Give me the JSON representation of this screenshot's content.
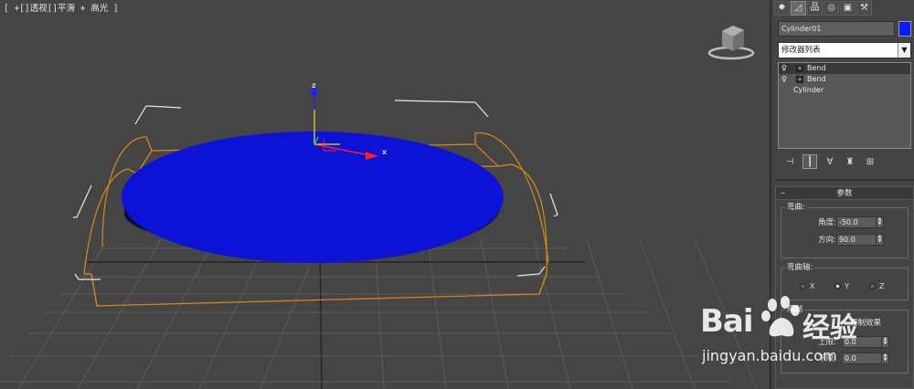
{
  "viewport": {
    "label": "[ +[]透视[]平滑 + 高光 ]",
    "axis_labels": {
      "x": "x",
      "z": "z"
    },
    "object_color": "#0d13d6"
  },
  "command_panel": {
    "tabs": [
      {
        "icon": "create-icon",
        "glyph": "✸"
      },
      {
        "icon": "modify-icon",
        "glyph": "◿"
      },
      {
        "icon": "hierarchy-icon",
        "glyph": "品"
      },
      {
        "icon": "motion-icon",
        "glyph": "◎"
      },
      {
        "icon": "display-icon",
        "glyph": "▣"
      },
      {
        "icon": "utilities-icon",
        "glyph": "⚒"
      }
    ],
    "object_name": "Cylinder01",
    "object_color": "#0a1cff",
    "modifier_list": {
      "value": "修改器列表",
      "arrow": "▼"
    },
    "modifier_stack": [
      {
        "label": "Bend",
        "selected": true
      },
      {
        "label": "Bend",
        "selected": false
      },
      {
        "label": "Cylinder",
        "base": true
      }
    ],
    "stack_tools": [
      {
        "icon": "pin-stack-icon",
        "glyph": "⊣"
      },
      {
        "icon": "show-end-result-icon",
        "glyph": "┃"
      },
      {
        "icon": "make-unique-icon",
        "glyph": "∀"
      },
      {
        "icon": "remove-modifier-icon",
        "glyph": "♜"
      },
      {
        "icon": "configure-sets-icon",
        "glyph": "⊞"
      }
    ],
    "parameters": {
      "rollout_toggle": "–",
      "rollout_title": "参数",
      "bend_group": {
        "title": "弯曲:",
        "angle_label": "角度:",
        "angle_value": "-50.0",
        "direction_label": "方向:",
        "direction_value": "90.0"
      },
      "axis_group": {
        "title": "弯曲轴:",
        "options": [
          "X",
          "Y",
          "Z"
        ],
        "selected": "Y"
      },
      "limit_group": {
        "title": "限制",
        "checkbox_label": "限制效果",
        "upper_label": "上限:",
        "upper_value": "0.0",
        "lower_label": "下限:",
        "lower_value": "0.0"
      }
    }
  },
  "watermark": {
    "logo_text_1": "Bai",
    "logo_text_2": "经验",
    "url": "jingyan.baidu.com"
  }
}
